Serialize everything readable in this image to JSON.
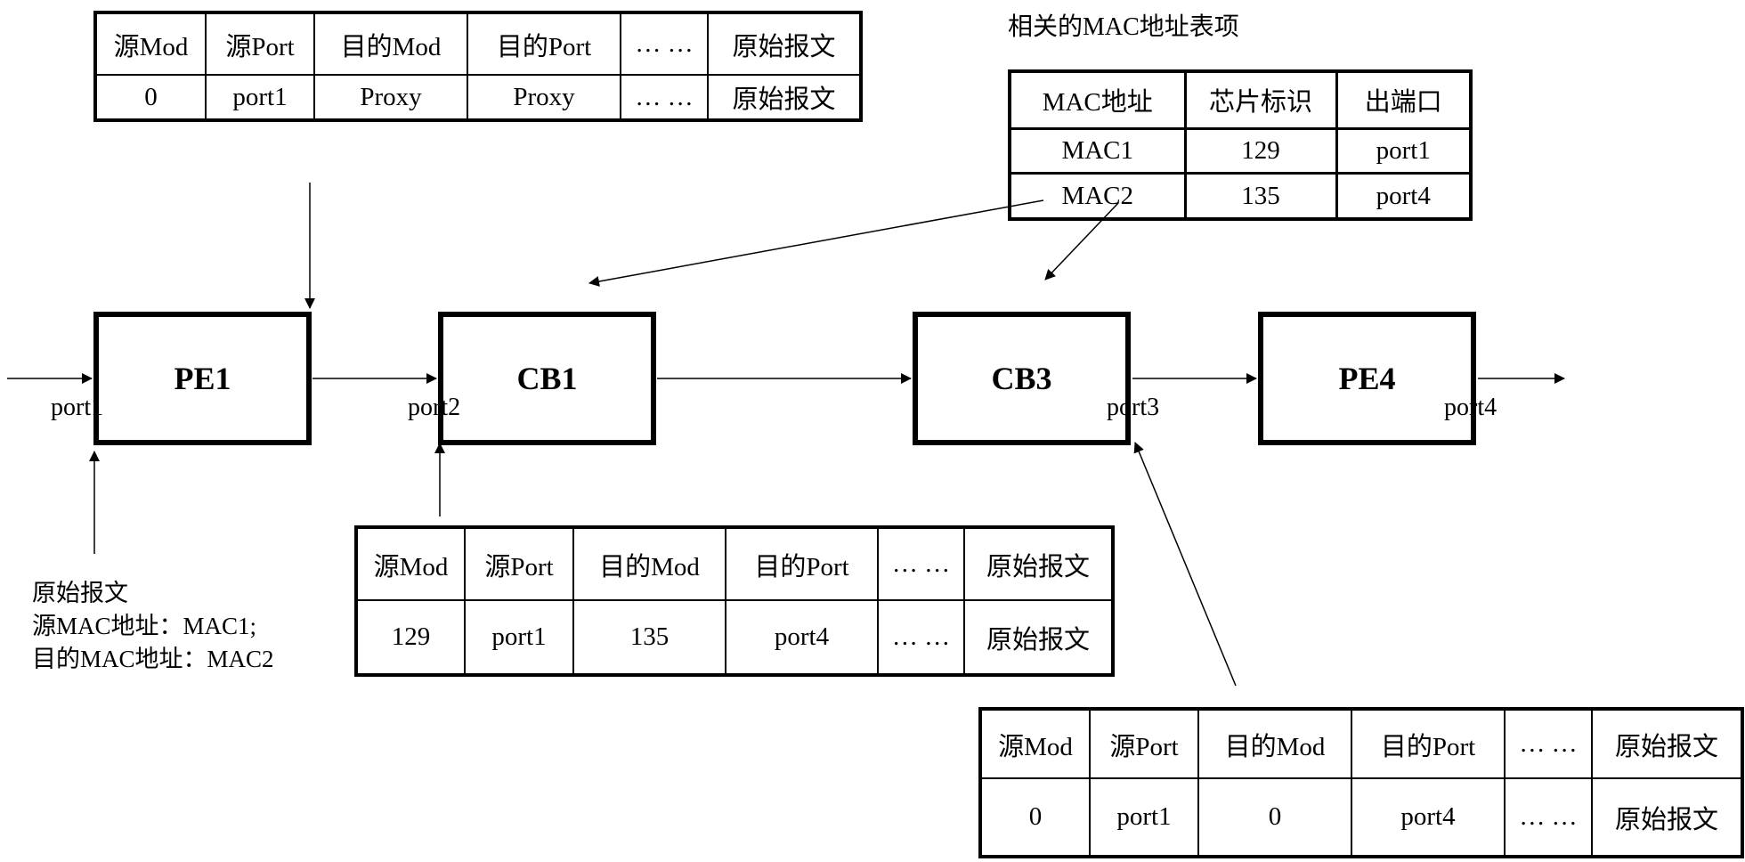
{
  "diagram": {
    "nodes": [
      {
        "id": "PE1",
        "label": "PE1"
      },
      {
        "id": "CB1",
        "label": "CB1"
      },
      {
        "id": "CB3",
        "label": "CB3"
      },
      {
        "id": "PE4",
        "label": "PE4"
      }
    ],
    "ports": [
      "port1",
      "port2",
      "port3",
      "port4"
    ],
    "top_packet_table": {
      "headers": [
        "源Mod",
        "源Port",
        "目的Mod",
        "目的Port",
        "… …",
        "原始报文"
      ],
      "row": [
        "0",
        "port1",
        "Proxy",
        "Proxy",
        "… …",
        "原始报文"
      ]
    },
    "middle_packet_table": {
      "headers": [
        "源Mod",
        "源Port",
        "目的Mod",
        "目的Port",
        "… …",
        "原始报文"
      ],
      "row": [
        "129",
        "port1",
        "135",
        "port4",
        "… …",
        "原始报文"
      ]
    },
    "bottom_packet_table": {
      "headers": [
        "源Mod",
        "源Port",
        "目的Mod",
        "目的Port",
        "… …",
        "原始报文"
      ],
      "row": [
        "0",
        "port1",
        "0",
        "port4",
        "… …",
        "原始报文"
      ]
    },
    "mac_table": {
      "title": "相关的MAC地址表项",
      "headers": [
        "MAC地址",
        "芯片标识",
        "出端口"
      ],
      "rows": [
        [
          "MAC1",
          "129",
          "port1"
        ],
        [
          "MAC2",
          "135",
          "port4"
        ]
      ]
    },
    "original_packet_note": {
      "line1": "原始报文",
      "line2": "源MAC地址：MAC1;",
      "line3": "目的MAC地址：MAC2"
    }
  }
}
